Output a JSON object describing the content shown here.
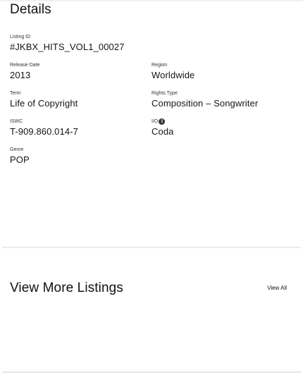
{
  "details": {
    "title": "Details",
    "listing_id": {
      "label": "Listing ID",
      "value": "#JKBX_HITS_VOL1_00027"
    },
    "release_date": {
      "label": "Release Date",
      "value": "2013"
    },
    "region": {
      "label": "Region",
      "value": "Worldwide"
    },
    "term": {
      "label": "Term",
      "value": "Life of Copyright"
    },
    "rights_type": {
      "label": "Rights Type",
      "value": "Composition – Songwriter"
    },
    "iswc": {
      "label": "ISWC",
      "value": "T-909.860.014-7"
    },
    "io": {
      "label": "I/O",
      "value": "Coda",
      "icon": "info-icon"
    },
    "genre": {
      "label": "Genre",
      "value": "POP"
    }
  },
  "listings": {
    "title": "View More Listings",
    "view_all_label": "View All"
  }
}
